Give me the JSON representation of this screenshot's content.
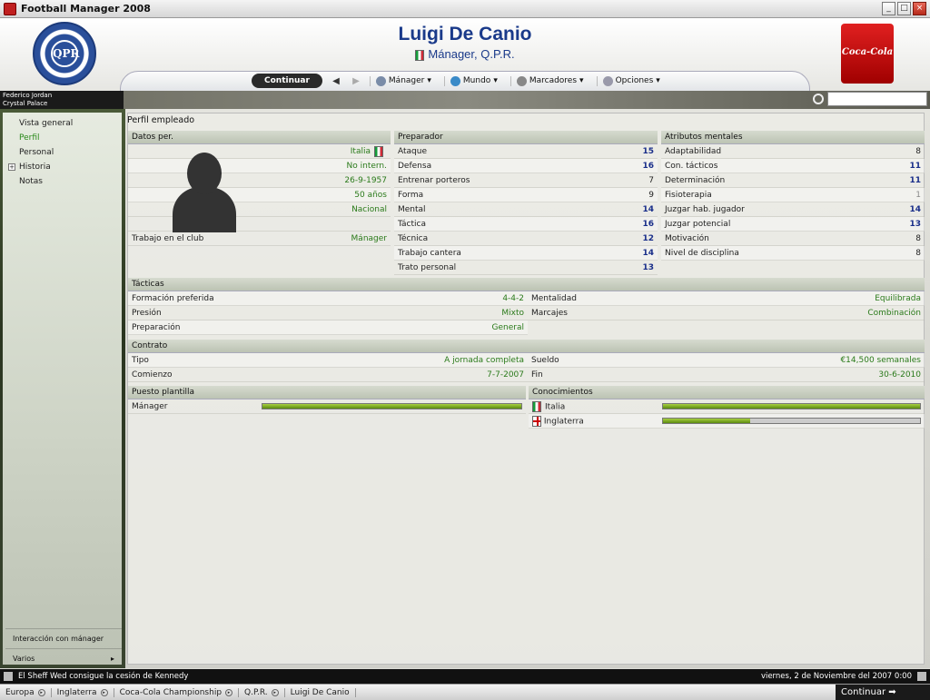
{
  "app": {
    "title": "Football Manager 2008"
  },
  "header": {
    "person_name": "Luigi De Canio",
    "person_role": "Mánager, Q.P.R.",
    "crest_text": "QPR",
    "sponsor_text": "Coca-Cola"
  },
  "nav": {
    "continue": "Continuar",
    "menus": [
      "Mánager",
      "Mundo",
      "Marcadores",
      "Opciones"
    ]
  },
  "user": {
    "name": "Federico Jordan",
    "club": "Crystal Palace"
  },
  "sidebar": {
    "items": [
      {
        "label": "Vista general",
        "active": false
      },
      {
        "label": "Perfil",
        "active": true
      },
      {
        "label": "Personal",
        "active": false
      },
      {
        "label": "Historia",
        "active": false,
        "expandable": true
      },
      {
        "label": "Notas",
        "active": false
      }
    ],
    "footer": [
      {
        "label": "Interacción con mánager"
      },
      {
        "label": "Varios"
      }
    ]
  },
  "page": {
    "title": "Perfil empleado"
  },
  "personal": {
    "header": "Datos per.",
    "rows": [
      "Italia",
      "No intern.",
      "26-9-1957",
      "50 años",
      "Nacional"
    ],
    "club_job_label": "Trabajo en el club",
    "club_job_value": "Mánager"
  },
  "coach": {
    "header": "Preparador",
    "rows": [
      {
        "label": "Ataque",
        "value": "15"
      },
      {
        "label": "Defensa",
        "value": "16"
      },
      {
        "label": "Entrenar porteros",
        "value": "7"
      },
      {
        "label": "Forma",
        "value": "9"
      },
      {
        "label": "Mental",
        "value": "14"
      },
      {
        "label": "Táctica",
        "value": "16"
      },
      {
        "label": "Técnica",
        "value": "12"
      },
      {
        "label": "Trabajo cantera",
        "value": "14"
      },
      {
        "label": "Trato personal",
        "value": "13"
      }
    ]
  },
  "mental": {
    "header": "Atributos mentales",
    "rows": [
      {
        "label": "Adaptabilidad",
        "value": "8"
      },
      {
        "label": "Con. tácticos",
        "value": "11"
      },
      {
        "label": "Determinación",
        "value": "11"
      },
      {
        "label": "Fisioterapia",
        "value": "1"
      },
      {
        "label": "Juzgar hab. jugador",
        "value": "14"
      },
      {
        "label": "Juzgar potencial",
        "value": "13"
      },
      {
        "label": "Motivación",
        "value": "8"
      },
      {
        "label": "Nivel de disciplina",
        "value": "8"
      }
    ]
  },
  "tactics": {
    "header": "Tácticas",
    "left": [
      {
        "label": "Formación preferida",
        "value": "4-4-2"
      },
      {
        "label": "Presión",
        "value": "Mixto"
      },
      {
        "label": "Preparación",
        "value": "General"
      }
    ],
    "right": [
      {
        "label": "Mentalidad",
        "value": "Equilibrada"
      },
      {
        "label": "Marcajes",
        "value": "Combinación"
      }
    ]
  },
  "contract": {
    "header": "Contrato",
    "left": [
      {
        "label": "Tipo",
        "value": "A jornada completa"
      },
      {
        "label": "Comienzo",
        "value": "7-7-2007"
      }
    ],
    "right": [
      {
        "label": "Sueldo",
        "value": "€14,500 semanales"
      },
      {
        "label": "Fin",
        "value": "30-6-2010"
      }
    ]
  },
  "squad_role": {
    "header": "Puesto plantilla",
    "label": "Mánager",
    "level": 1.0
  },
  "knowledge": {
    "header": "Conocimientos",
    "items": [
      {
        "label": "Italia",
        "level": 1.0
      },
      {
        "label": "Inglaterra",
        "level": 0.34
      }
    ]
  },
  "status": {
    "news": "El Sheff Wed consigue la cesión de Kennedy",
    "date": "viernes, 2 de Noviembre del 2007 0:00"
  },
  "breadcrumbs": [
    "Europa",
    "Inglaterra",
    "Coca-Cola Championship",
    "Q.P.R.",
    "Luigi De Canio"
  ],
  "bottom_continue": "Continuar",
  "colors": {
    "accent_blue": "#1a3a8a",
    "value_green": "#2a7a1a",
    "stat_blue": "#1a2f8a",
    "bar_green": "#7ab02a"
  }
}
